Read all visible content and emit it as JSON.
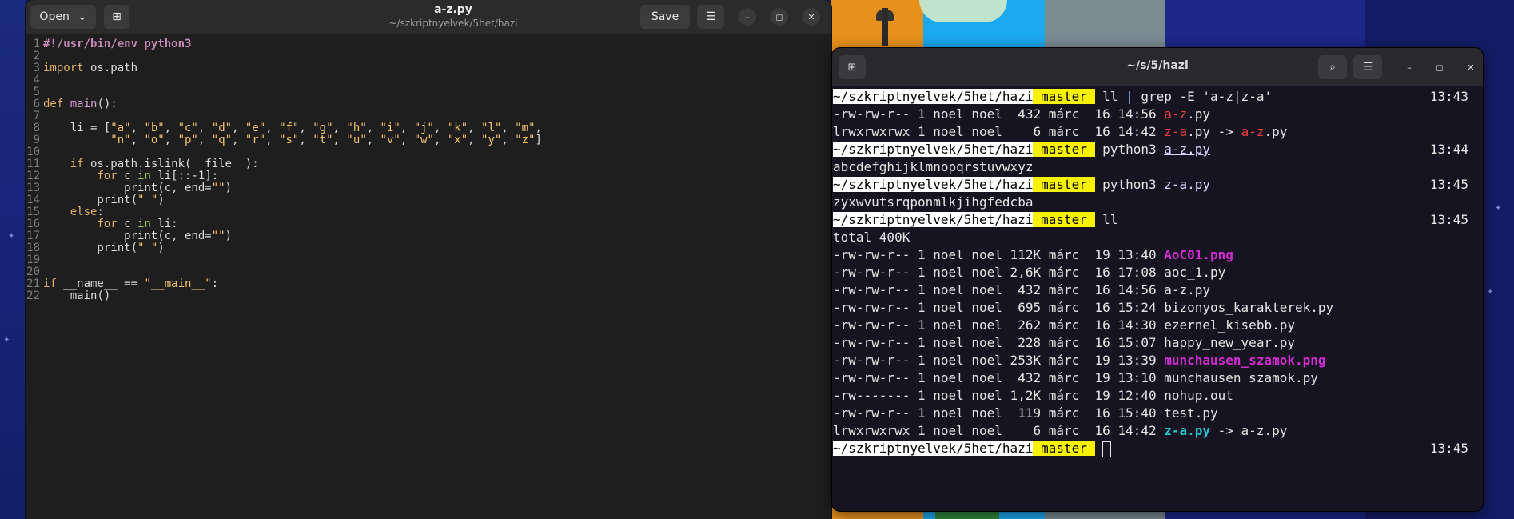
{
  "editor": {
    "open_label": "Open",
    "open_chevron": "chevron-down-icon",
    "new_tab_icon": "new-tab-icon",
    "save_label": "Save",
    "menu_icon": "hamburger-menu-icon",
    "title": "a-z.py",
    "subtitle": "~/szkriptnyelvek/5het/hazi",
    "code_lines": [
      {
        "n": "1",
        "t": "#!/usr/bin/env python3"
      },
      {
        "n": "2",
        "t": ""
      },
      {
        "n": "3",
        "t": "import os.path"
      },
      {
        "n": "4",
        "t": ""
      },
      {
        "n": "5",
        "t": ""
      },
      {
        "n": "6",
        "t": "def main():"
      },
      {
        "n": "7",
        "t": ""
      },
      {
        "n": "8",
        "t": "    li = [\"a\", \"b\", \"c\", \"d\", \"e\", \"f\", \"g\", \"h\", \"i\", \"j\", \"k\", \"l\", \"m\","
      },
      {
        "n": "9",
        "t": "          \"n\", \"o\", \"p\", \"q\", \"r\", \"s\", \"t\", \"u\", \"v\", \"w\", \"x\", \"y\", \"z\"]"
      },
      {
        "n": "10",
        "t": ""
      },
      {
        "n": "11",
        "t": "    if os.path.islink(__file__):"
      },
      {
        "n": "12",
        "t": "        for c in li[::-1]:"
      },
      {
        "n": "13",
        "t": "            print(c, end=\"\")"
      },
      {
        "n": "14",
        "t": "        print(\" \")"
      },
      {
        "n": "15",
        "t": "    else:"
      },
      {
        "n": "16",
        "t": "        for c in li:"
      },
      {
        "n": "17",
        "t": "            print(c, end=\"\")"
      },
      {
        "n": "18",
        "t": "        print(\" \")"
      },
      {
        "n": "19",
        "t": ""
      },
      {
        "n": "20",
        "t": ""
      },
      {
        "n": "21",
        "t": "if __name__ == \"__main__\":"
      },
      {
        "n": "22",
        "t": "    main()"
      }
    ]
  },
  "terminal": {
    "title": "~/s/5/hazi",
    "prompt_dir": "~/szkriptnyelvek/5het/hazi",
    "prompt_branch": "master",
    "cmd1_a": "ll ",
    "cmd1_pipe": "|",
    "cmd1_b": " grep -E 'a-z|z-a'",
    "time1": "13:43",
    "out1_perm": "-rw-rw-r-- 1 noel noel  432 márc  16 14:56 ",
    "out1_name": "a-z",
    "out1_ext": ".py",
    "out2_perm": "lrwxrwxrwx 1 noel noel    6 márc  16 14:42 ",
    "out2_name": "z-a",
    "out2_mid": ".py -> ",
    "out2_target": "a-z",
    "out2_ext": ".py",
    "cmd2": "python3 ",
    "cmd2_file": "a-z.py",
    "time2": "13:44",
    "out3": "abcdefghijklmnopqrstuvwxyz",
    "cmd3": "python3 ",
    "cmd3_file": "z-a.py",
    "time3": "13:45",
    "out4": "zyxwvutsrqponmlkjihgfedcba",
    "cmd4": "ll",
    "time4": "13:45",
    "total": "total 400K",
    "listing": [
      {
        "perm": "-rw-rw-r-- 1 noel noel 112K márc  19 13:40 ",
        "name": "AoC01.png",
        "cls": "mag",
        "tail": ""
      },
      {
        "perm": "-rw-rw-r-- 1 noel noel 2,6K márc  16 17:08 ",
        "name": "aoc_1.py",
        "cls": "",
        "tail": ""
      },
      {
        "perm": "-rw-rw-r-- 1 noel noel  432 márc  16 14:56 ",
        "name": "a-z.py",
        "cls": "",
        "tail": ""
      },
      {
        "perm": "-rw-rw-r-- 1 noel noel  695 márc  16 15:24 ",
        "name": "bizonyos_karakterek.py",
        "cls": "",
        "tail": ""
      },
      {
        "perm": "-rw-rw-r-- 1 noel noel  262 márc  16 14:30 ",
        "name": "ezernel_kisebb.py",
        "cls": "",
        "tail": ""
      },
      {
        "perm": "-rw-rw-r-- 1 noel noel  228 márc  16 15:07 ",
        "name": "happy_new_year.py",
        "cls": "",
        "tail": ""
      },
      {
        "perm": "-rw-rw-r-- 1 noel noel 253K márc  19 13:39 ",
        "name": "munchausen_szamok.png",
        "cls": "mag",
        "tail": ""
      },
      {
        "perm": "-rw-rw-r-- 1 noel noel  432 márc  19 13:10 ",
        "name": "munchausen_szamok.py",
        "cls": "",
        "tail": ""
      },
      {
        "perm": "-rw------- 1 noel noel 1,2K márc  19 12:40 ",
        "name": "nohup.out",
        "cls": "",
        "tail": ""
      },
      {
        "perm": "-rw-rw-r-- 1 noel noel  119 márc  16 15:40 ",
        "name": "test.py",
        "cls": "",
        "tail": ""
      },
      {
        "perm": "lrwxrwxrwx 1 noel noel    6 márc  16 14:42 ",
        "name": "z-a.py",
        "cls": "cyan",
        "tail": " -> a-z.py"
      }
    ],
    "time5": "13:45"
  }
}
